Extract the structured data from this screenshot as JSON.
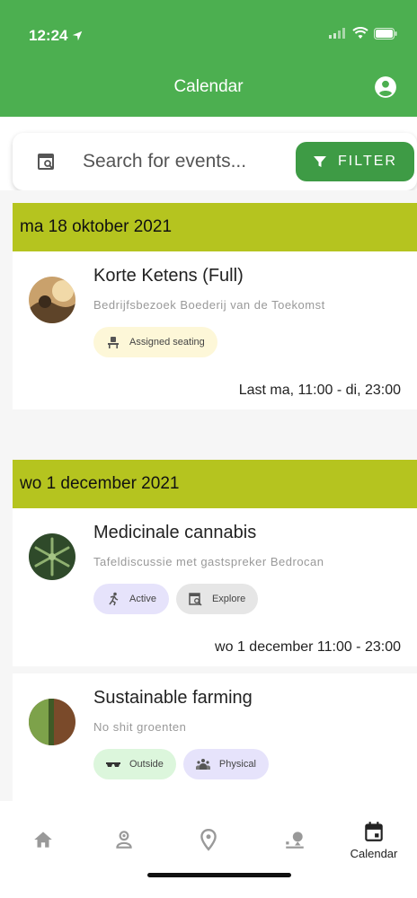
{
  "status_bar": {
    "time": "12:24"
  },
  "header": {
    "title": "Calendar",
    "account_icon": "account-circle-icon"
  },
  "search": {
    "placeholder": "Search for events...",
    "filter_label": "FILTER"
  },
  "sections": [
    {
      "date": "ma 18 oktober 2021",
      "events": [
        {
          "title": "Korte Ketens (Full)",
          "subtitle": "Bedrijfsbezoek Boederij van de Toekomst",
          "tags": [
            {
              "label": "Assigned seating",
              "icon": "seat-icon"
            }
          ],
          "time": "Last ma, 11:00 - di, 23:00"
        }
      ]
    },
    {
      "date": "wo 1 december 2021",
      "events": [
        {
          "title": "Medicinale cannabis",
          "subtitle": "Tafeldiscussie met gastspreker Bedrocan",
          "tags": [
            {
              "label": "Active",
              "icon": "running-icon"
            },
            {
              "label": "Explore",
              "icon": "explore-icon"
            }
          ],
          "time": "wo 1 december 11:00 - 23:00"
        },
        {
          "title": "Sustainable farming",
          "subtitle": "No shit groenten",
          "tags": [
            {
              "label": "Outside",
              "icon": "sunglasses-icon"
            },
            {
              "label": "Physical",
              "icon": "group-icon"
            }
          ]
        }
      ]
    }
  ],
  "bottom_nav": [
    {
      "icon": "home-icon"
    },
    {
      "icon": "people-icon"
    },
    {
      "icon": "location-pin-icon"
    },
    {
      "icon": "person-pin-icon"
    },
    {
      "icon": "calendar-icon",
      "label": "Calendar"
    }
  ],
  "colors": {
    "header": "#4caf50",
    "filter_button": "#3e9b45",
    "date_header": "#b5c41f"
  }
}
